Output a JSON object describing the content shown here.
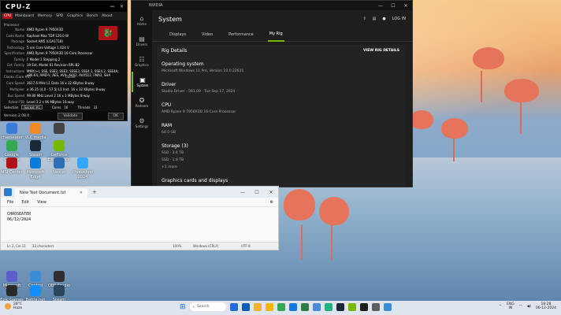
{
  "desktop": {
    "icons": [
      {
        "label": "chaoseater",
        "color": "#3a7bd5"
      },
      {
        "label": "VLC media player",
        "color": "#f08a24"
      },
      {
        "label": "",
        "color": "#444444"
      },
      {
        "label": "Google Chrome",
        "color": "#34a853"
      },
      {
        "label": "Steam",
        "color": "#1b2838"
      },
      {
        "label": "GeForce Experience",
        "color": "#76b900"
      },
      {
        "label": "MSI Center",
        "color": "#b0121a"
      },
      {
        "label": "Microsoft Edge",
        "color": "#0c7bdc"
      },
      {
        "label": "Nexus",
        "color": "#2f6fb3"
      },
      {
        "label": "Photoshop 2024",
        "color": "#31a8ff"
      },
      {
        "label": "Microsoft Teams",
        "color": "#5b5fc7"
      },
      {
        "label": "Control Panel",
        "color": "#3c8dd8"
      },
      {
        "label": "OBS Studio",
        "color": "#302e31"
      },
      {
        "label": "Epic Games Launcher",
        "color": "#2a2a2a"
      },
      {
        "label": "Battle.net",
        "color": "#148eff"
      },
      {
        "label": "Steam Games",
        "color": "#2a475e"
      }
    ]
  },
  "cpuz": {
    "title": "CPU-Z",
    "tabs": [
      "CPU",
      "Mainboard",
      "Memory",
      "SPD",
      "Graphics",
      "Bench",
      "About"
    ],
    "processor_header": "Processor",
    "rows": [
      {
        "k": "Name",
        "v": "AMD Ryzen 9 7950X3D"
      },
      {
        "k": "Code Name",
        "v": "Raphael        Max TDP  120.0 W"
      },
      {
        "k": "Package",
        "v": "Socket AM5 (LGA1718)"
      },
      {
        "k": "Technology",
        "v": "5 nm    Core Voltage  1.024 V"
      },
      {
        "k": "Specification",
        "v": "AMD Ryzen 9 7950X3D 16-Core Processor"
      },
      {
        "k": "Family",
        "v": "F     Model  1     Stepping  2"
      },
      {
        "k": "Ext. Family",
        "v": "19    Ext. Model  61    Revision  RPL-B2"
      },
      {
        "k": "Instructions",
        "v": "MMX(+), SSE, SSE2, SSE3, SSSE3, SSE4.1, SSE4.2, SSE4A, x86-64, AMD-V, AES, AVX, AVX2, AVX512, FMA3, SHA"
      },
      {
        "k": "Core Speed",
        "v": "3617.6 MHz   L1 Data  16 x 32 KBytes  8-way"
      },
      {
        "k": "Multiplier",
        "v": "x 36.25 (4.0 - 57.5)  L1 Inst.  16 x 32 KBytes  8-way"
      },
      {
        "k": "Bus Speed",
        "v": "99.80 MHz   Level 2  16 x 1 MBytes  8-way"
      },
      {
        "k": "Rated FSB",
        "v": "           Level 3  2 x 96 MBytes  16-way"
      }
    ],
    "clocks_header": "Clocks (Core #0)",
    "cache_header": "Cache",
    "selection_label": "Selection",
    "selection_value": "Socket #1",
    "cores_label": "Cores",
    "cores_value": "16",
    "threads_label": "Threads",
    "threads_value": "32",
    "version": "Version 2.08.0",
    "validate_label": "Validate",
    "ok_label": "OK"
  },
  "nvidia": {
    "window_title": "NVIDIA",
    "page_title": "System",
    "login_label": "LOG IN",
    "sidebar": [
      {
        "glyph": "⌂",
        "label": "Home"
      },
      {
        "glyph": "▤",
        "label": "Drivers"
      },
      {
        "glyph": "☷",
        "label": "Graphics"
      },
      {
        "glyph": "▣",
        "label": "System"
      },
      {
        "glyph": "✪",
        "label": "Redeem"
      },
      {
        "glyph": "⚙",
        "label": "Settings"
      }
    ],
    "tabs": [
      "Displays",
      "Video",
      "Performance",
      "My Rig"
    ],
    "active_tab": "My Rig",
    "rig_details_title": "Rig Details",
    "view_rig_details": "VIEW RIG DETAILS",
    "sections": [
      {
        "heading": "Operating system",
        "detail": "Microsoft Windows 11 Pro, Version 10.0.22631"
      },
      {
        "heading": "Driver",
        "detail": "Studio Driver - 561.09 - Tue Sep 17, 2024"
      },
      {
        "heading": "CPU",
        "detail": "AMD Ryzen 9 7950X3D 16-Core Processor"
      },
      {
        "heading": "RAM",
        "detail": "64.0 GB"
      },
      {
        "heading": "Storage (3)",
        "detail": "SSD - 3.6 TB\nSSD - 1.8 TB\n+1 more"
      },
      {
        "heading": "Graphics cards and displays",
        "detail": ""
      }
    ]
  },
  "notepad": {
    "tab_title": "New Text Document.txt",
    "menu": [
      "File",
      "Edit",
      "View"
    ],
    "lines": [
      "CHAOSEATER",
      "06/12/2024"
    ],
    "status": {
      "position": "Ln 2, Col 11",
      "chars": "22 characters",
      "zoom": "100%",
      "eol": "Windows (CRLF)",
      "encoding": "UTF-8"
    }
  },
  "taskbar": {
    "weather_temp": "28°C",
    "weather_desc": "Haze",
    "search_label": "Search",
    "app_colors": [
      "#1f6fd6",
      "#0a5db4",
      "#f2b134",
      "#f4b400",
      "#34a853",
      "#0f7bdc",
      "#2d7d46",
      "#4a8ad8",
      "#23b27f",
      "#1b2838",
      "#76b900",
      "#1e1e1e",
      "#5e5e5e",
      "#3c8dd8"
    ],
    "lang_top": "ENG",
    "lang_bottom": "IN",
    "time": "18:28",
    "date": "06-12-2024"
  }
}
